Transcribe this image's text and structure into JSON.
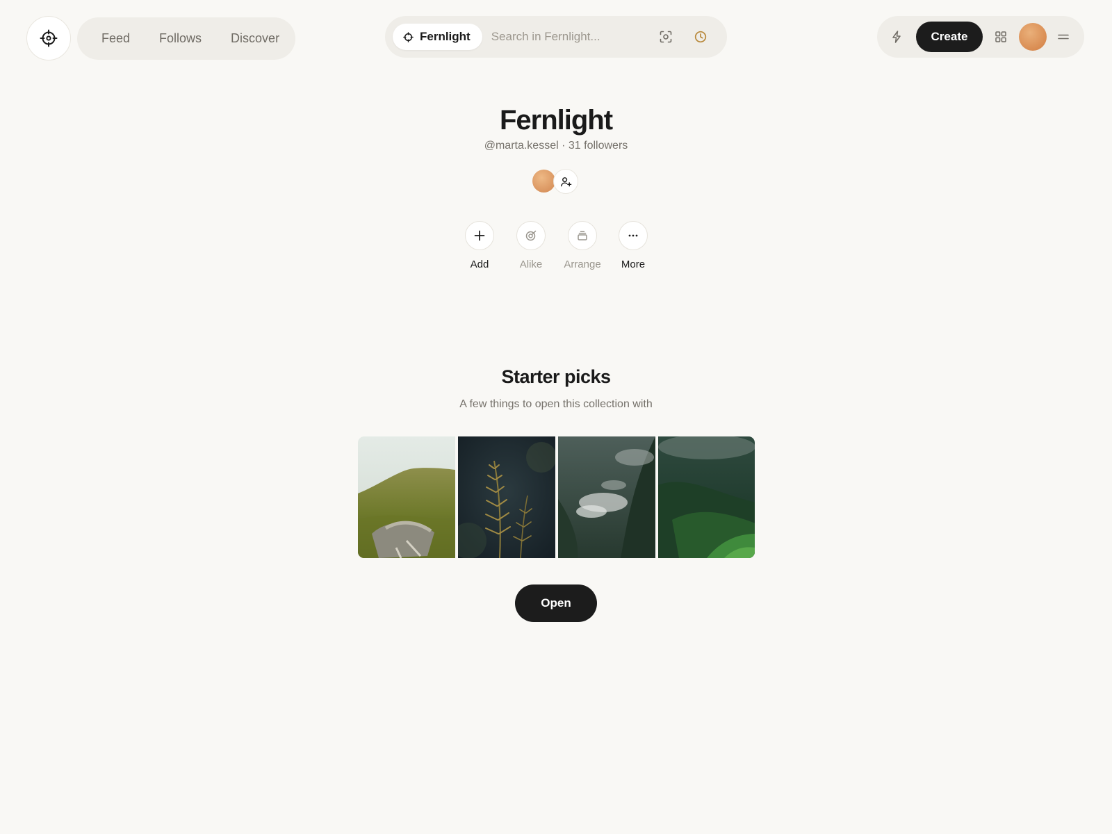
{
  "nav": {
    "logo_icon": "crosshair-logo-icon",
    "links": [
      {
        "label": "Feed"
      },
      {
        "label": "Follows"
      },
      {
        "label": "Discover"
      }
    ]
  },
  "search": {
    "scope_label": "Fernlight",
    "placeholder": "Search in Fernlight...",
    "value": "",
    "icons": [
      "visual-search-icon",
      "history-clock-icon"
    ]
  },
  "toolbar": {
    "create_label": "Create",
    "icons": [
      "lightning-icon",
      "grid-icon",
      "avatar",
      "menu-icon"
    ]
  },
  "collection": {
    "title": "Fernlight",
    "handle": "@marta.kessel",
    "separator": "·",
    "followers": "31 followers"
  },
  "actions": [
    {
      "label": "Add",
      "enabled": true,
      "icon": "plus-icon"
    },
    {
      "label": "Alike",
      "enabled": false,
      "icon": "target-icon"
    },
    {
      "label": "Arrange",
      "enabled": false,
      "icon": "stack-icon"
    },
    {
      "label": "More",
      "enabled": true,
      "icon": "ellipsis-icon"
    }
  ],
  "starter": {
    "title": "Starter picks",
    "subtitle": "A few things to open this collection with",
    "images": [
      "grassy-hillside",
      "fern-frond",
      "misty-forest",
      "green-mountain-valley"
    ],
    "open_label": "Open"
  },
  "colors": {
    "background": "#f9f8f5",
    "pill": "#efede8",
    "primary_button": "#1c1c1c",
    "clock_accent": "#b8883a",
    "avatar": "#d98c52"
  }
}
